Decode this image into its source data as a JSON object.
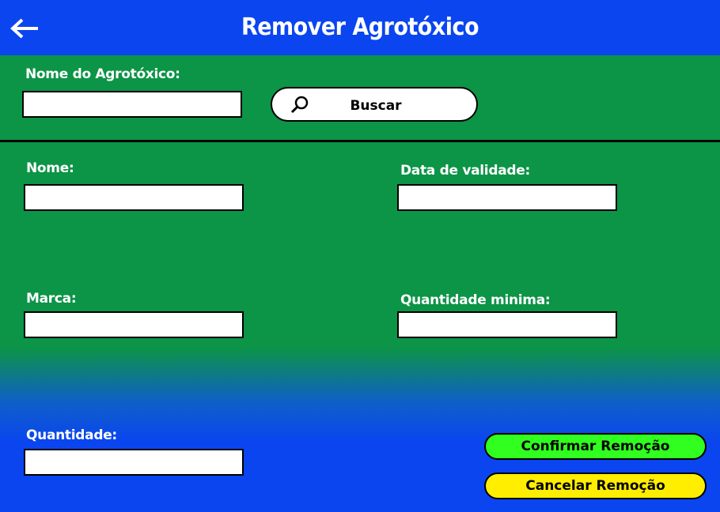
{
  "header": {
    "title": "Remover Agrotóxico",
    "back_icon": "arrow-left-icon"
  },
  "search": {
    "label": "Nome do Agrotóxico:",
    "value": "",
    "button_label": "Buscar",
    "button_icon": "search-icon"
  },
  "form": {
    "nome_label": "Nome:",
    "nome_value": "",
    "validade_label": "Data de validade:",
    "validade_value": "",
    "marca_label": "Marca:",
    "marca_value": "",
    "qtd_minima_label": "Quantidade minima:",
    "qtd_minima_value": "",
    "quantidade_label": "Quantidade:",
    "quantidade_value": ""
  },
  "actions": {
    "confirm_label": "Confirmar Remoção",
    "cancel_label": "Cancelar Remoção"
  },
  "colors": {
    "header_bg": "#0a45f0",
    "panel_green": "#0c9447",
    "confirm_bg": "#30ff1f",
    "cancel_bg": "#ffee00"
  }
}
